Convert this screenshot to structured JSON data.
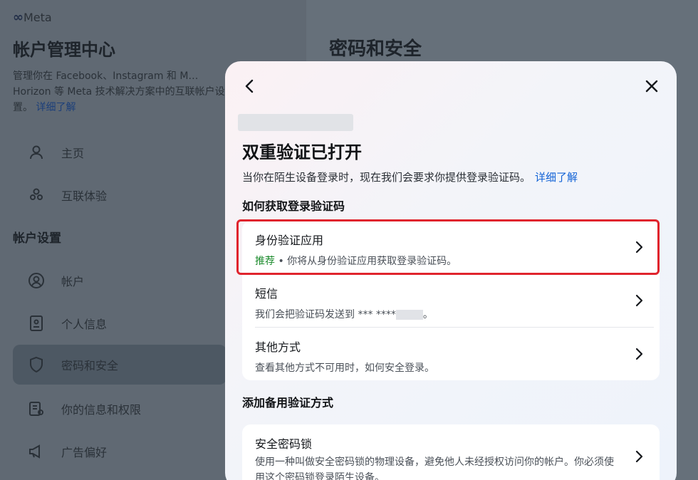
{
  "background": {
    "logo": "Meta",
    "account_center_title": "帐户管理中心",
    "account_center_desc": "管理你在 Facebook、Instagram 和 M… Horizon 等 Meta 技术解决方案中的互联帐户设置。",
    "learn_more": "详细了解",
    "right_title": "密码和安全",
    "nav": [
      {
        "label": "主页",
        "icon": "person-icon"
      },
      {
        "label": "互联体验",
        "icon": "people-icon"
      }
    ],
    "settings_heading": "帐户设置",
    "settings_nav": [
      {
        "label": "帐户",
        "icon": "account-circle-icon"
      },
      {
        "label": "个人信息",
        "icon": "id-card-icon"
      },
      {
        "label": "密码和安全",
        "icon": "shield-icon",
        "active": true
      },
      {
        "label": "你的信息和权限",
        "icon": "info-permission-icon"
      },
      {
        "label": "广告偏好",
        "icon": "megaphone-icon"
      }
    ]
  },
  "modal": {
    "title": "双重验证已打开",
    "description": "当你在陌生设备登录时，现在我们会要求你提供登录验证码。",
    "learn_more": "详细了解",
    "how_heading": "如何获取登录验证码",
    "options": [
      {
        "title": "身份验证应用",
        "recommended": "推荐",
        "subtitle": " • 你将从身份验证应用获取登录验证码。"
      },
      {
        "title": "短信",
        "subtitle": "我们会把验证码发送到 *** ****",
        "subtitle_suffix": "。"
      },
      {
        "title": "其他方式",
        "subtitle": "查看其他方式不可用时，如何安全登录。"
      }
    ],
    "add_heading": "添加备用验证方式",
    "backup_options": [
      {
        "title": "安全密码锁",
        "subtitle": "使用一种叫做安全密码锁的物理设备，避免他人未经授权访问你的帐户。你必须使用这个密码锁登录陌生设备。"
      }
    ]
  },
  "colors": {
    "highlight": "#e0242d",
    "link": "#1162d6",
    "recommended": "#1a8a2b"
  }
}
